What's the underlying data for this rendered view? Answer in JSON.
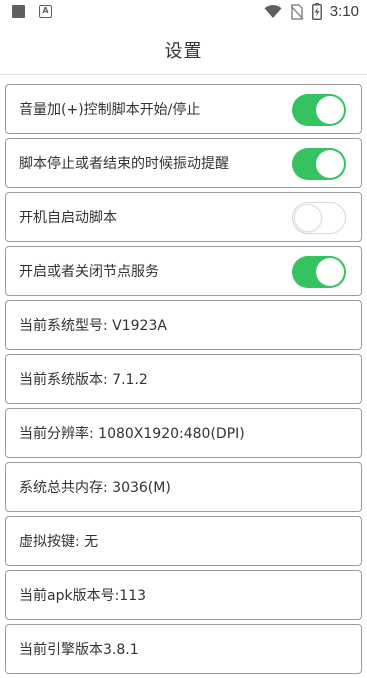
{
  "status_bar": {
    "time": "3:10",
    "icons": [
      "notification-square-icon",
      "app-a-icon",
      "wifi-icon",
      "no-sim-icon",
      "battery-charging-icon"
    ]
  },
  "header": {
    "title": "设置"
  },
  "toggles": [
    {
      "label": "音量加(+)控制脚本开始/停止",
      "on": true
    },
    {
      "label": "脚本停止或者结束的时候振动提醒",
      "on": true
    },
    {
      "label": "开机自启动脚本",
      "on": false
    },
    {
      "label": "开启或者关闭节点服务",
      "on": true
    }
  ],
  "info": [
    {
      "label": "当前系统型号: V1923A"
    },
    {
      "label": "当前系统版本: 7.1.2"
    },
    {
      "label": "当前分辨率: 1080X1920:480(DPI)"
    },
    {
      "label": "系统总共内存: 3036(M)"
    },
    {
      "label": "虚拟按键: 无"
    },
    {
      "label": "当前apk版本号:113"
    },
    {
      "label": "当前引擎版本3.8.1"
    }
  ],
  "colors": {
    "toggle_on": "#34c360",
    "card_border": "#9c9c9c",
    "text": "#333333"
  }
}
